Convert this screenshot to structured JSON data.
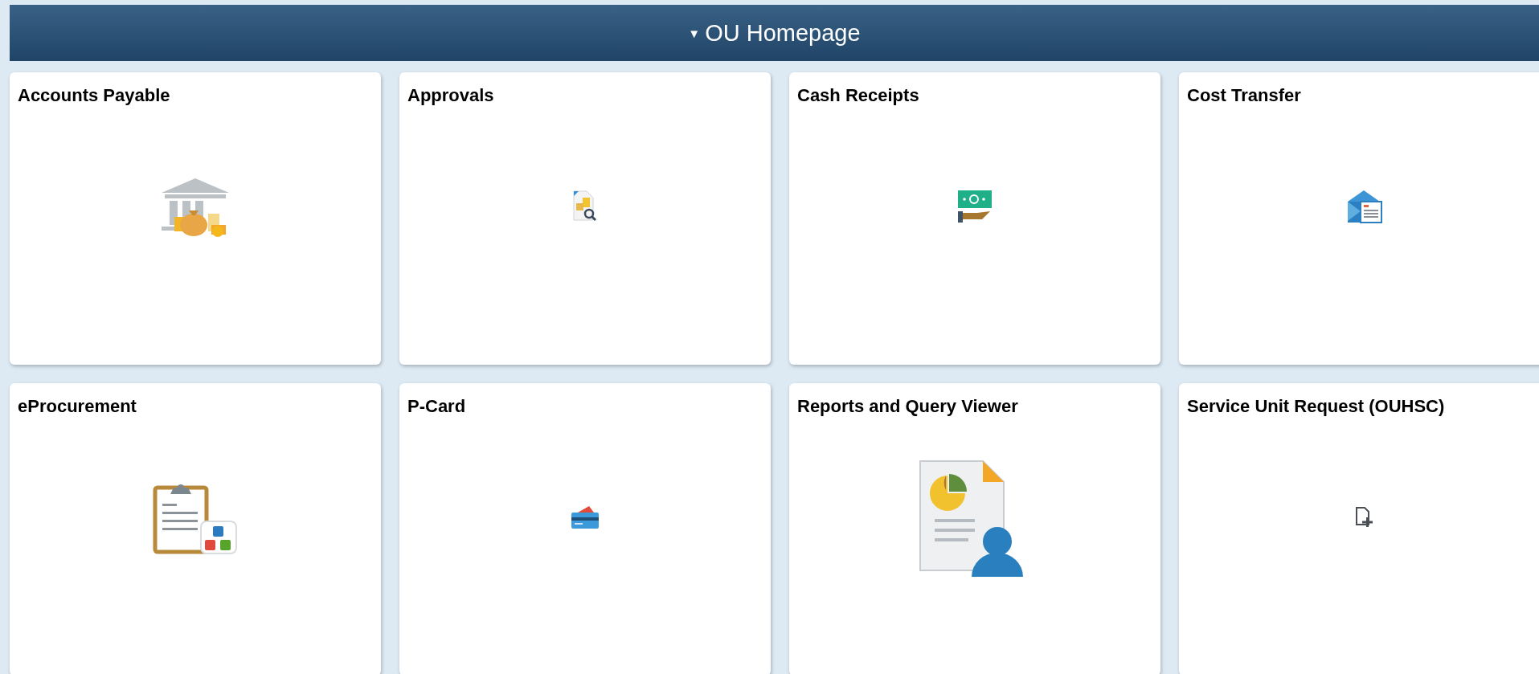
{
  "header": {
    "caret": "▼",
    "title": "OU Homepage"
  },
  "tiles": [
    {
      "title": "Accounts Payable"
    },
    {
      "title": "Approvals"
    },
    {
      "title": "Cash Receipts"
    },
    {
      "title": "Cost Transfer"
    },
    {
      "title": "eProcurement"
    },
    {
      "title": "P-Card"
    },
    {
      "title": "Reports and Query Viewer"
    },
    {
      "title": "Service Unit Request (OUHSC)"
    }
  ]
}
